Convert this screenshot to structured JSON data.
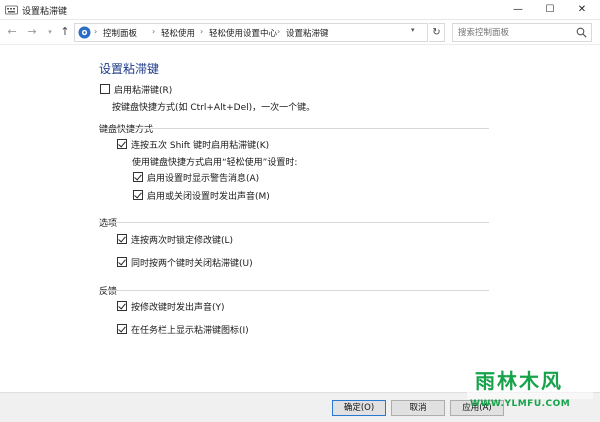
{
  "window": {
    "title": "设置粘滞键",
    "minimize_glyph": "—",
    "maximize_glyph": "☐",
    "close_glyph": "✕"
  },
  "navigation": {
    "back_glyph": "←",
    "forward_glyph": "→",
    "history_glyph": "▾",
    "up_glyph": "↑",
    "breadcrumbs": [
      "控制面板",
      "轻松使用",
      "轻松使用设置中心",
      "设置粘滞键"
    ],
    "separator": "›",
    "dropdown_glyph": "▾",
    "refresh_glyph": "↻",
    "search_placeholder": "搜索控制面板"
  },
  "main": {
    "heading": "设置粘滞键",
    "enable": {
      "label": "启用粘滞键(R)",
      "checked": false
    },
    "enable_desc": "按键盘快捷方式(如 Ctrl+Alt+Del)，一次一个键。",
    "keyboard_shortcut": {
      "title": "键盘快捷方式",
      "shift_five": {
        "label": "连按五次 Shift 键时启用粘滞键(K)",
        "checked": true
      },
      "sub_desc": "使用键盘快捷方式启用“轻松使用”设置时:",
      "show_warning": {
        "label": "启用设置时显示警告消息(A)",
        "checked": true
      },
      "make_sound": {
        "label": "启用或关闭设置时发出声音(M)",
        "checked": true
      }
    },
    "options": {
      "title": "选项",
      "lock_modifier": {
        "label": "连按两次时锁定修改键(L)",
        "checked": true
      },
      "turn_off": {
        "label": "同时按两个键时关闭粘滞键(U)",
        "checked": true
      }
    },
    "feedback": {
      "title": "反馈",
      "beep": {
        "label": "按修改键时发出声音(Y)",
        "checked": true
      },
      "taskbar_icon": {
        "label": "在任务栏上显示粘滞键图标(I)",
        "checked": true
      }
    }
  },
  "buttons": {
    "ok": "确定(O)",
    "cancel": "取消",
    "apply": "应用(A)"
  },
  "watermark": {
    "logo_text": "雨林木风",
    "url": "WWW.YLMFU.COM"
  },
  "colors": {
    "heading": "#1e3a8a",
    "ok_border": "#2a78d6",
    "watermark": "#16a34a"
  }
}
